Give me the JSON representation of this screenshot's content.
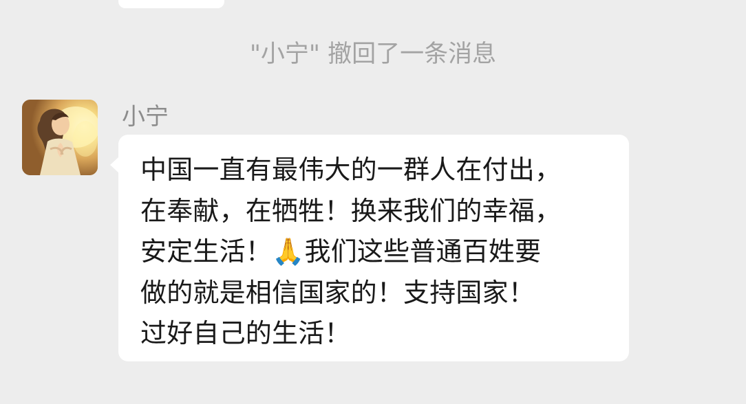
{
  "system_notice": "\"小宁\" 撤回了一条消息",
  "message": {
    "sender": "小宁",
    "lines": [
      "中国一直有最伟大的一群人在付出，",
      "在奉献，在牺牲！换来我们的幸福，",
      "安定生活！🙏我们这些普通百姓要",
      "做的就是相信国家的！支持国家！",
      "过好自己的生活！"
    ]
  },
  "icons": {
    "avatar": "praying-woman-avatar"
  },
  "colors": {
    "background": "#ededed",
    "bubble": "#ffffff",
    "message_text": "#191919",
    "sender_name": "#8c8c8c",
    "system_notice": "#a3a3a3"
  }
}
